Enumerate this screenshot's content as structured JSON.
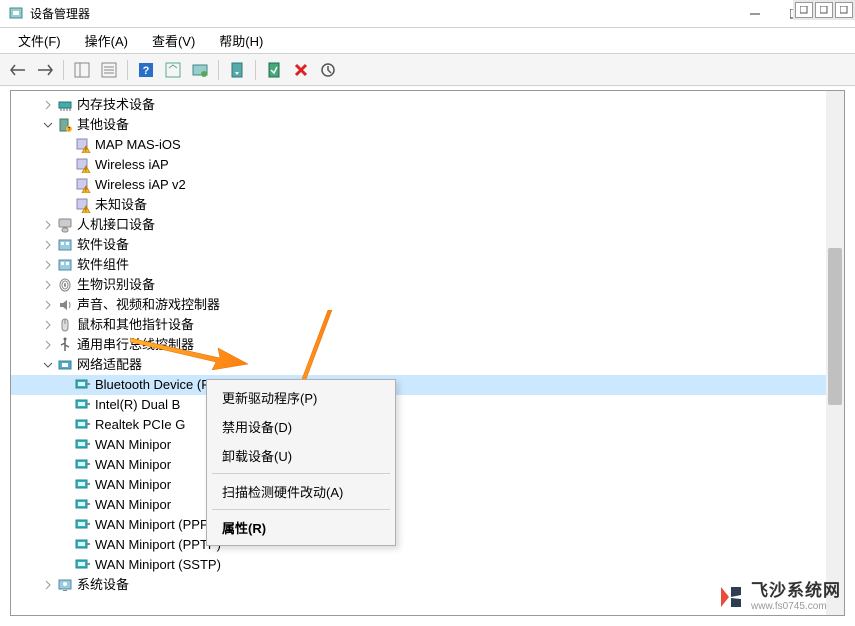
{
  "window": {
    "title": "设备管理器"
  },
  "menubar": {
    "file": "文件(F)",
    "action": "操作(A)",
    "view": "查看(V)",
    "help": "帮助(H)"
  },
  "tree": [
    {
      "indent": 0,
      "expander": "right",
      "icon": "memory",
      "label": "内存技术设备"
    },
    {
      "indent": 0,
      "expander": "down",
      "icon": "other",
      "label": "其他设备"
    },
    {
      "indent": 1,
      "expander": "",
      "icon": "unknown-warn",
      "label": "MAP MAS-iOS"
    },
    {
      "indent": 1,
      "expander": "",
      "icon": "unknown-warn",
      "label": "Wireless iAP"
    },
    {
      "indent": 1,
      "expander": "",
      "icon": "unknown-warn",
      "label": "Wireless iAP v2"
    },
    {
      "indent": 1,
      "expander": "",
      "icon": "unknown-warn",
      "label": "未知设备"
    },
    {
      "indent": 0,
      "expander": "right",
      "icon": "hid",
      "label": "人机接口设备"
    },
    {
      "indent": 0,
      "expander": "right",
      "icon": "software",
      "label": "软件设备"
    },
    {
      "indent": 0,
      "expander": "right",
      "icon": "software",
      "label": "软件组件"
    },
    {
      "indent": 0,
      "expander": "right",
      "icon": "biometric",
      "label": "生物识别设备"
    },
    {
      "indent": 0,
      "expander": "right",
      "icon": "audio",
      "label": "声音、视频和游戏控制器"
    },
    {
      "indent": 0,
      "expander": "right",
      "icon": "mouse",
      "label": "鼠标和其他指针设备"
    },
    {
      "indent": 0,
      "expander": "right",
      "icon": "usb",
      "label": "通用串行总线控制器"
    },
    {
      "indent": 0,
      "expander": "down",
      "icon": "network",
      "label": "网络适配器"
    },
    {
      "indent": 1,
      "expander": "",
      "icon": "netadapter",
      "label": "Bluetooth Device (Personal Area Network)",
      "selected": true
    },
    {
      "indent": 1,
      "expander": "",
      "icon": "netadapter",
      "label": "Intel(R) Dual B"
    },
    {
      "indent": 1,
      "expander": "",
      "icon": "netadapter",
      "label": "Realtek PCIe G"
    },
    {
      "indent": 1,
      "expander": "",
      "icon": "netadapter",
      "label": "WAN Minipor"
    },
    {
      "indent": 1,
      "expander": "",
      "icon": "netadapter",
      "label": "WAN Minipor"
    },
    {
      "indent": 1,
      "expander": "",
      "icon": "netadapter",
      "label": "WAN Minipor"
    },
    {
      "indent": 1,
      "expander": "",
      "icon": "netadapter",
      "label": "WAN Minipor"
    },
    {
      "indent": 1,
      "expander": "",
      "icon": "netadapter",
      "label": "WAN Miniport (PPPOE)"
    },
    {
      "indent": 1,
      "expander": "",
      "icon": "netadapter",
      "label": "WAN Miniport (PPTP)"
    },
    {
      "indent": 1,
      "expander": "",
      "icon": "netadapter",
      "label": "WAN Miniport (SSTP)"
    },
    {
      "indent": 0,
      "expander": "right",
      "icon": "system",
      "label": "系统设备"
    }
  ],
  "context_menu": [
    {
      "label": "更新驱动程序(P)",
      "type": "item"
    },
    {
      "label": "禁用设备(D)",
      "type": "item"
    },
    {
      "label": "卸载设备(U)",
      "type": "item"
    },
    {
      "type": "sep"
    },
    {
      "label": "扫描检测硬件改动(A)",
      "type": "item"
    },
    {
      "type": "sep"
    },
    {
      "label": "属性(R)",
      "type": "bold"
    }
  ],
  "watermark": {
    "title": "飞沙系统网",
    "url": "www.fs0745.com"
  }
}
